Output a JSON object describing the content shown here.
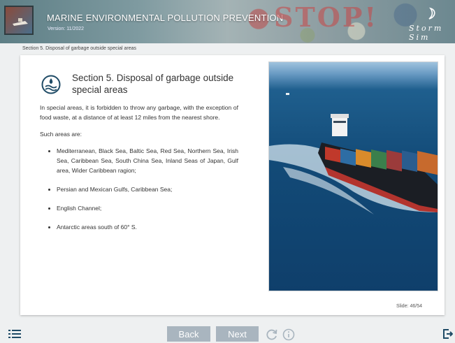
{
  "header": {
    "title": "MARINE ENVIRONMENTAL POLLUTION PREVENTION",
    "version": "Version: 11/2022",
    "stop_text": "STOP!",
    "brand": "Storm Sim"
  },
  "breadcrumb": "Section 5. Disposal of garbage outside special areas",
  "section": {
    "title": "Section 5. Disposal of garbage outside special areas",
    "intro": "In special areas, it is forbidden to throw any garbage, with the exception of food waste, at a distance of at least 12 miles from the nearest shore.",
    "list_heading": "Such areas are:",
    "items": [
      "Mediterranean, Black Sea, Baltic Sea, Red Sea, Northern Sea, Irish Sea, Caribbean Sea, South China Sea, Inland Seas of Japan, Gulf area, Wider Caribbean ragion;",
      "Persian and Mexican Gulfs, Caribbean Sea;",
      "English Channel;",
      "Antarctic areas south of 60° S."
    ]
  },
  "slide_counter": "Slide: 46/54",
  "nav": {
    "back_label": "Back",
    "next_label": "Next"
  },
  "icons": {
    "menu": "list-menu-icon",
    "reload": "reload-icon",
    "info": "info-icon",
    "exit": "exit-icon",
    "section": "marine-pollution-icon"
  },
  "colors": {
    "nav_button": "#a9b5bf",
    "icon": "#1f4b66"
  }
}
